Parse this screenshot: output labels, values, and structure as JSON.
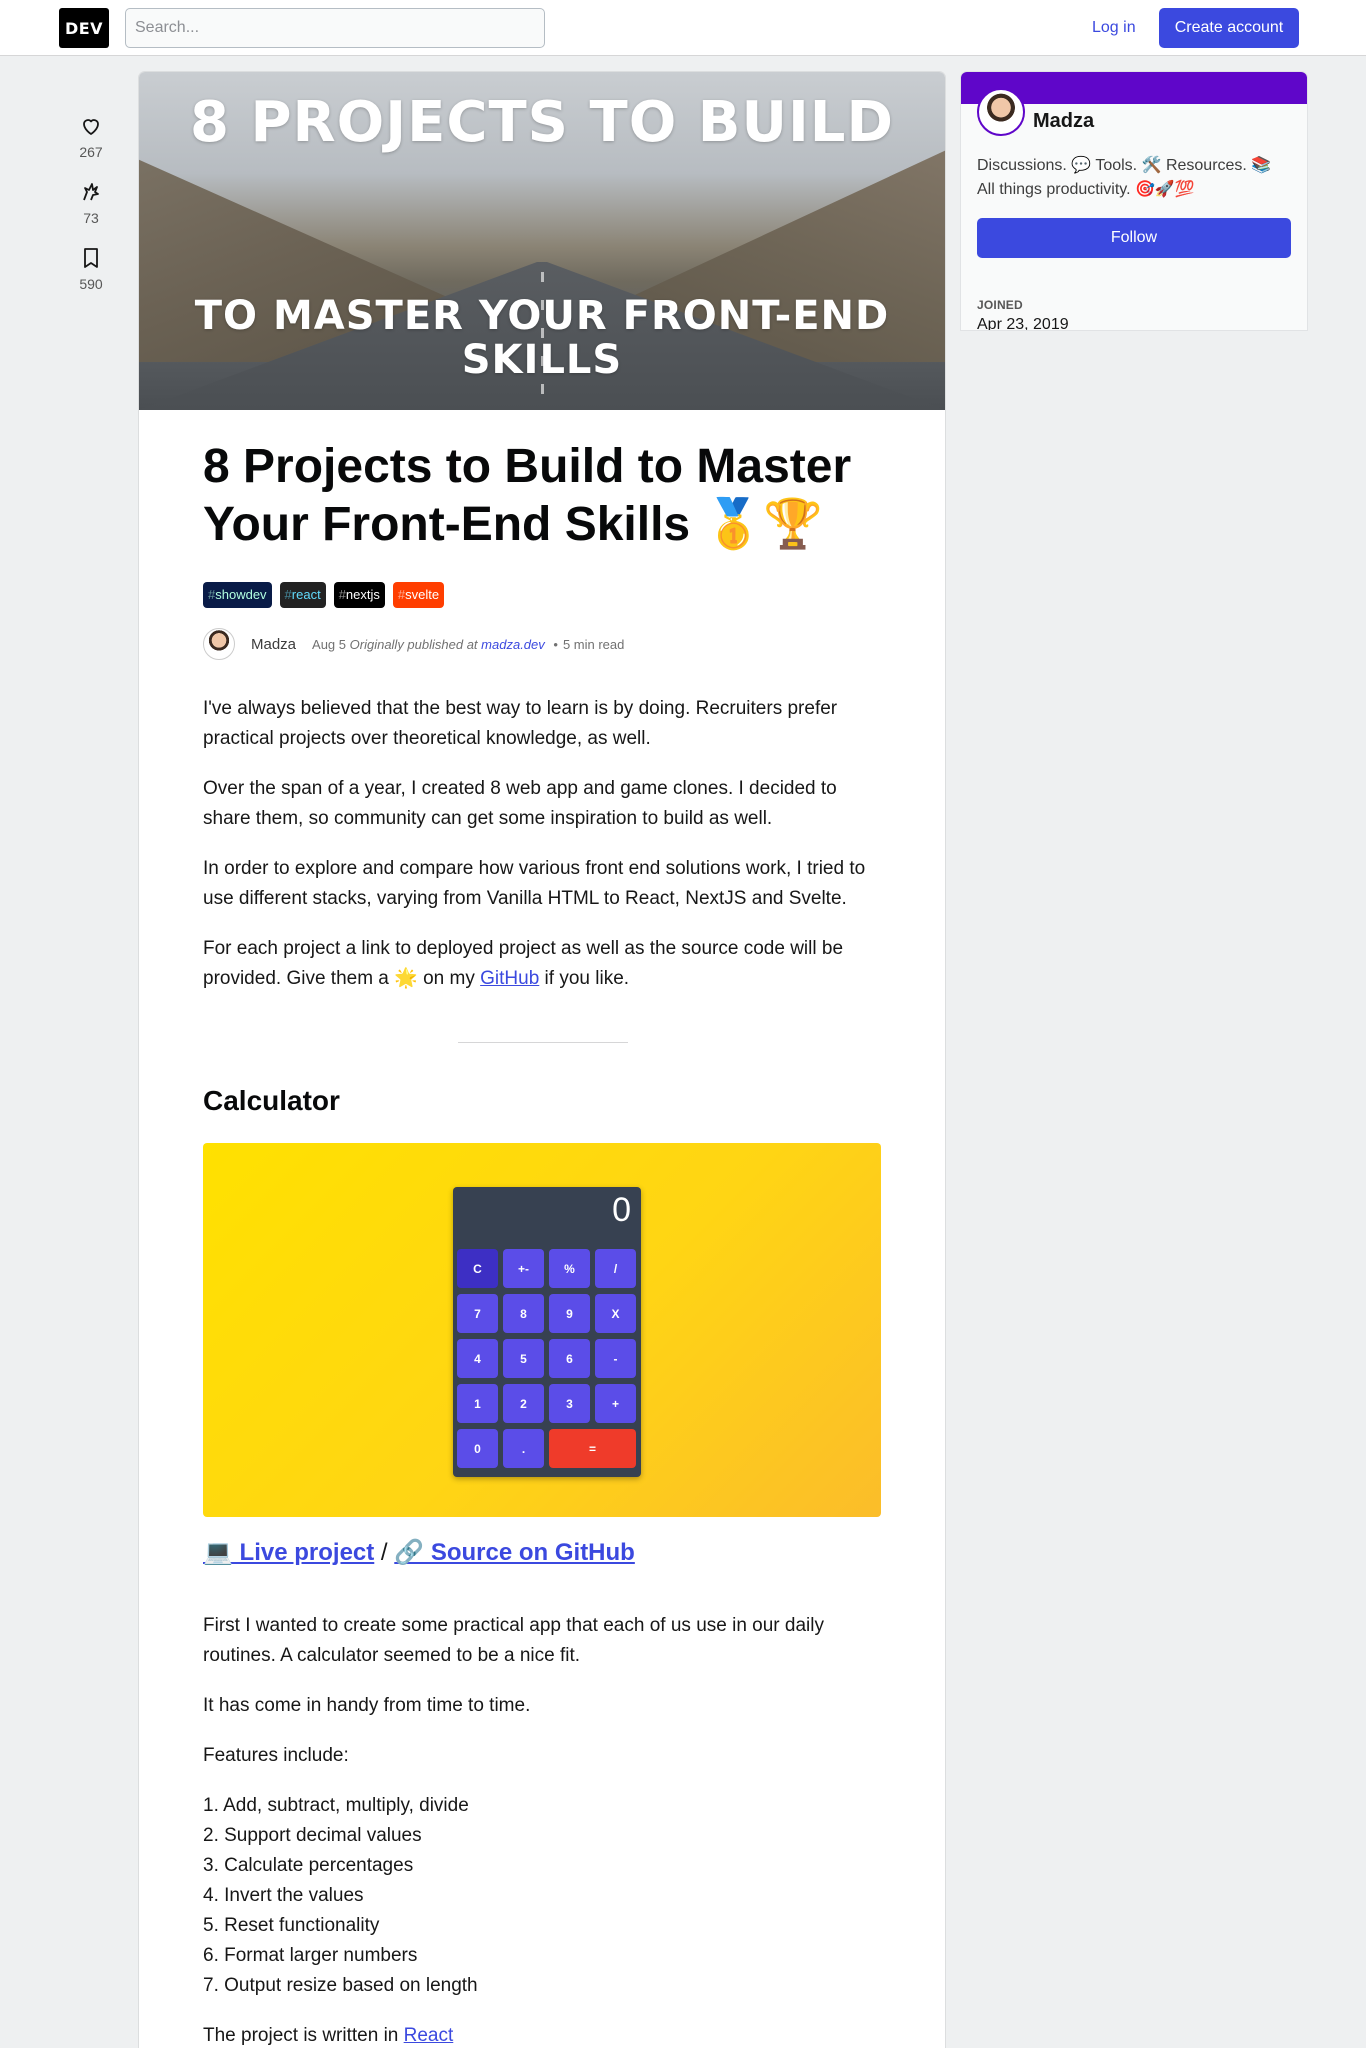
{
  "header": {
    "logo": "DEV",
    "search_placeholder": "Search...",
    "login": "Log in",
    "create_account": "Create account"
  },
  "reactions": {
    "hearts": "267",
    "unicorns": "73",
    "saves": "590"
  },
  "cover": {
    "line1": "8 PROJECTS TO BUILD",
    "line2": "TO MASTER YOUR FRONT-END SKILLS"
  },
  "article": {
    "title": "8 Projects to Build to Master Your Front-End Skills 🥇🏆",
    "tags": [
      {
        "name": "showdev",
        "bg": "#091b47",
        "fg": "#b2ffe1"
      },
      {
        "name": "react",
        "bg": "#222222",
        "fg": "#61dafb"
      },
      {
        "name": "nextjs",
        "bg": "#000000",
        "fg": "#ffffff"
      },
      {
        "name": "svelte",
        "bg": "#ff3e00",
        "fg": "#ffffff"
      }
    ],
    "author": "Madza",
    "date": "Aug 5",
    "originally": "Originally published at",
    "origin_link": "madza.dev",
    "read_time": "5 min read",
    "paragraphs": [
      "I've always believed that the best way to learn is by doing. Recruiters prefer practical projects over theoretical knowledge, as well.",
      "Over the span of a year, I created 8 web app and game clones. I decided to share them, so community can get some inspiration to build as well.",
      "In order to explore and compare how various front end solutions work, I tried to use different stacks, varying from Vanilla HTML to React, NextJS and Svelte."
    ],
    "p4_before": "For each project a link to deployed project as well as the source code will be provided. Give them a ",
    "p4_star": "🌟",
    "p4_mid": " on my ",
    "p4_link": "GitHub",
    "p4_after": " if you like.",
    "section_title": "Calculator",
    "calculator": {
      "display": "0",
      "keys": [
        "C",
        "+-",
        "%",
        "/",
        "7",
        "8",
        "9",
        "X",
        "4",
        "5",
        "6",
        "-",
        "1",
        "2",
        "3",
        "+",
        "0",
        ".",
        "="
      ]
    },
    "live_link": "💻 Live project",
    "sep": " / ",
    "source_link": "🔗 Source on GitHub",
    "p5": "First I wanted to create some practical app that each of us use in our daily routines. A calculator seemed to be a nice fit.",
    "p6": "It has come in handy from time to time.",
    "p7": "Features include:",
    "features": [
      "1. Add, subtract, multiply, divide",
      "2. Support decimal values",
      "3. Calculate percentages",
      "4. Invert the values",
      "5. Reset functionality",
      "6. Format larger numbers",
      "7. Output resize based on length"
    ],
    "p8_before": "The project is written in ",
    "p8_link": "React"
  },
  "sidebar": {
    "name": "Madza",
    "bio": "Discussions. 💬 Tools. 🛠️ Resources. 📚 All things productivity. 🎯🚀💯",
    "follow": "Follow",
    "joined_label": "JOINED",
    "joined_value": "Apr 23, 2019",
    "brand_color": "#5f06c9"
  }
}
